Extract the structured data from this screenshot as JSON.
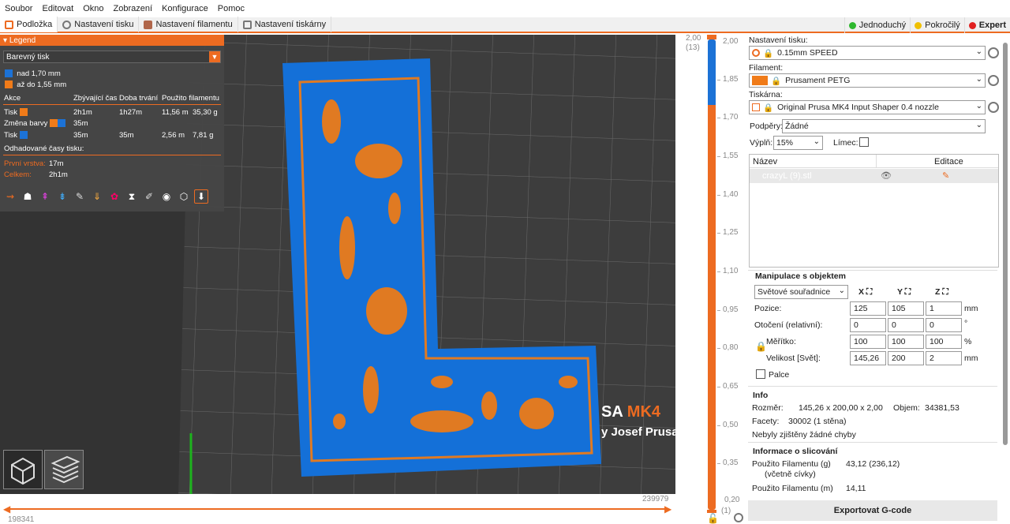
{
  "menu": [
    "Soubor",
    "Editovat",
    "Okno",
    "Zobrazení",
    "Konfigurace",
    "Pomoc"
  ],
  "tabs": [
    "Podložka",
    "Nastavení tisku",
    "Nastavení filamentu",
    "Nastavení tiskárny"
  ],
  "modes": [
    {
      "label": "Jednoduchý",
      "color": "#2eb82e"
    },
    {
      "label": "Pokročilý",
      "color": "#f0c000"
    },
    {
      "label": "Expert",
      "color": "#e02020"
    }
  ],
  "legend": {
    "title": "Legend",
    "view_type": "Barevný tisk",
    "colors": [
      {
        "label": "nad 1,70 mm",
        "color": "#1c72d6"
      },
      {
        "label": "až do 1,55 mm",
        "color": "#f07b19"
      }
    ],
    "columns": [
      "Akce",
      "Zbývající čas",
      "Doba trvání",
      "Použito filamentu"
    ],
    "rows": [
      {
        "action": "Tisk",
        "remaining": "2h1m",
        "duration": "1h27m",
        "length": "11,56 m",
        "weight": "35,30 g"
      },
      {
        "action": "Změna barvy",
        "remaining": "35m",
        "duration": "",
        "length": "",
        "weight": ""
      },
      {
        "action": "Tisk",
        "remaining": "35m",
        "duration": "35m",
        "length": "2,56 m",
        "weight": "7,81 g"
      }
    ],
    "est_title": "Odhadované časy tisku:",
    "first_layer_label": "První vrstva:",
    "first_layer": "17m",
    "total_label": "Celkem:",
    "total": "2h1m"
  },
  "bed": {
    "brand": "SA MK4",
    "brand_left": "SA",
    "brand_right": "MK4",
    "author": "y Josef Prusa"
  },
  "hslider": {
    "left": "198341",
    "right": "239979"
  },
  "vslider": {
    "top_value": "2,00",
    "top_layer": "(13)",
    "bottom_value": "0,20",
    "bottom_layer": "(1)",
    "fill_fraction_blue": 0.14,
    "ticks": [
      "2,00",
      "1,85",
      "1,70",
      "1,55",
      "1,40",
      "1,25",
      "1,10",
      "0,95",
      "0,80",
      "0,65",
      "0,50",
      "0,35",
      "0,20"
    ]
  },
  "sidebar": {
    "print_settings_label": "Nastavení tisku:",
    "print_settings": "0.15mm SPEED",
    "filament_label": "Filament:",
    "filament": "Prusament PETG",
    "filament_color": "#f07b19",
    "printer_label": "Tiskárna:",
    "printer": "Original Prusa MK4 Input Shaper 0.4 nozzle",
    "supports_label": "Podpěry:",
    "supports": "Žádné",
    "infill_label": "Výplň:",
    "infill": "15%",
    "brim_label": "Límec:",
    "obj_cols": [
      "Název",
      "Editace"
    ],
    "object_name": "crazyL (9).stl",
    "manip_title": "Manipulace s objektem",
    "coords": "Světové souřadnice",
    "axes": [
      "X",
      "Y",
      "Z"
    ],
    "position_label": "Pozice:",
    "position": [
      "125",
      "105",
      "1"
    ],
    "position_unit": "mm",
    "rotation_label": "Otočení (relativní):",
    "rotation": [
      "0",
      "0",
      "0"
    ],
    "rotation_unit": "°",
    "scale_label": "Měřítko:",
    "scale": [
      "100",
      "100",
      "100"
    ],
    "scale_unit": "%",
    "size_label": "Velikost [Svět]:",
    "size": [
      "145,26",
      "200",
      "2"
    ],
    "size_unit": "mm",
    "inches_label": "Palce",
    "info_title": "Info",
    "size_info_label": "Rozměr:",
    "size_info": "145,26 x 200,00 x 2,00",
    "volume_label": "Objem:",
    "volume": "34381,53",
    "facets_label": "Facety:",
    "facets": "30002 (1 stěna)",
    "errors": "Nebyly zjištěny žádné chyby",
    "slice_title": "Informace o slicování",
    "fil_g_label": "Použito Filamentu (g)",
    "fil_g_sub": "(včetně cívky)",
    "fil_g": "43,12 (236,12)",
    "fil_m_label": "Použito Filamentu (m)",
    "fil_m": "14,11",
    "export": "Exportovat G-code"
  }
}
